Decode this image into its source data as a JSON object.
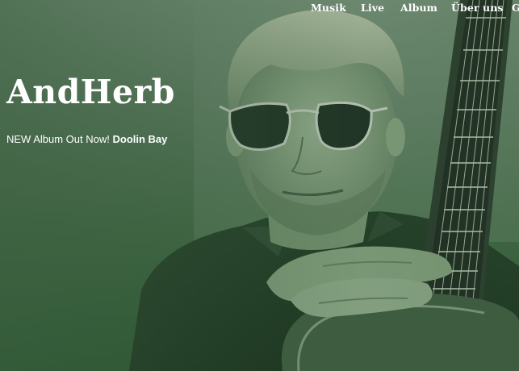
{
  "nav": {
    "items": [
      {
        "label": "Musik"
      },
      {
        "label": "Live"
      },
      {
        "label": "Album"
      },
      {
        "label": "Über uns"
      },
      {
        "label": "G"
      }
    ]
  },
  "hero": {
    "title": "AndHerb",
    "tagline_prefix": "NEW Album Out Now!",
    "tagline_link": "Doolin Bay",
    "image_icon": "musician-with-guitar-photo"
  },
  "colors": {
    "overlay": "#3c5f40",
    "text": "#ffffff"
  }
}
